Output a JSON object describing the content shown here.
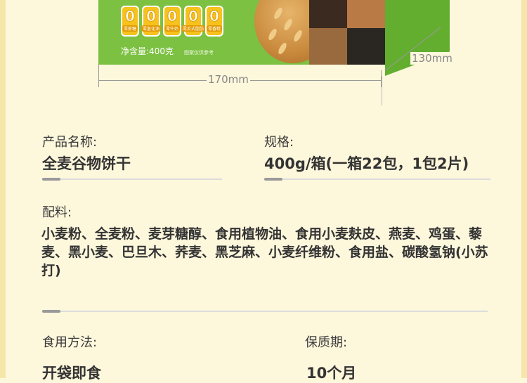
{
  "product_box": {
    "badges": [
      {
        "mark": "0",
        "label": "零蔗糖"
      },
      {
        "mark": "0",
        "label": "零氢化油"
      },
      {
        "mark": "0",
        "label": "零牛奶"
      },
      {
        "mark": "0",
        "label": "零反式脂肪"
      },
      {
        "mark": "0",
        "label": "零香精"
      }
    ],
    "net_weight_label": "净含量:",
    "net_weight_value": "400克",
    "image_note": "图案仅供参考",
    "width_dimension": "170mm",
    "depth_dimension": "130mm"
  },
  "info": {
    "product_name_label": "产品名称:",
    "product_name_value": "全麦谷物饼干",
    "spec_label": "规格:",
    "spec_value": "400g/箱(一箱22包，1包2片)",
    "ingredients_label": "配料:",
    "ingredients_value": "小麦粉、全麦粉、麦芽糖醇、食用植物油、食用小麦麸皮、燕麦、鸡蛋、藜麦、黑小麦、巴旦木、荞麦、黑芝麻、小麦纤维粉、食用盐、碳酸氢钠(小苏打)",
    "usage_label": "食用方法:",
    "usage_value": "开袋即食",
    "shelf_life_label": "保质期:",
    "shelf_life_value": "10个月"
  },
  "colors": {
    "box_green": "#7cc142",
    "badge_yellow": "#f6c21e",
    "background": "#fdf7dc"
  }
}
